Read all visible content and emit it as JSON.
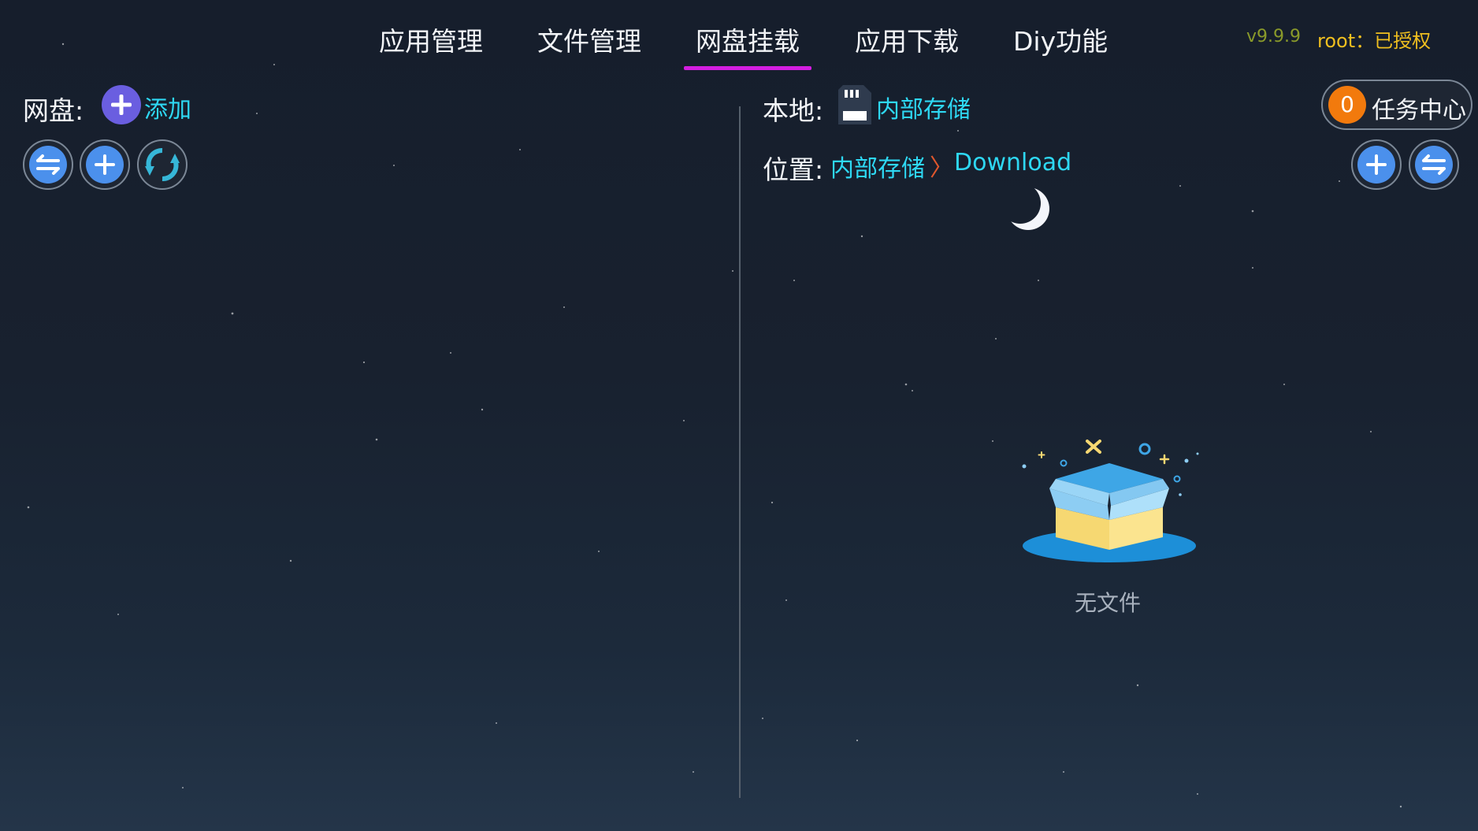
{
  "tabs": [
    {
      "label": "应用管理",
      "active": false
    },
    {
      "label": "文件管理",
      "active": false
    },
    {
      "label": "网盘挂载",
      "active": true
    },
    {
      "label": "应用下载",
      "active": false
    },
    {
      "label": "Diy功能",
      "active": false
    }
  ],
  "status": {
    "version": "v9.9.9",
    "root": "root：已授权"
  },
  "left_panel": {
    "label": "网盘:",
    "add_label": "添加",
    "toolbar": [
      "swap-icon",
      "plus-icon",
      "refresh-icon"
    ]
  },
  "right_panel": {
    "local_label": "本地:",
    "storage_name": "内部存储",
    "path_label": "位置:",
    "breadcrumb": [
      "内部存储",
      "Download"
    ],
    "separator": "〉",
    "task_center": {
      "count": "0",
      "label": "任务中心"
    },
    "toolbar": [
      "plus-icon",
      "swap-icon"
    ],
    "empty_text": "无文件"
  },
  "colors": {
    "accent_link": "#2ed8f3",
    "tab_indicator": "#d31ee0",
    "version": "#8a9a2a",
    "root_status": "#f0bf1f",
    "task_badge": "#f27a0d",
    "button_fill": "#4b90ec",
    "add_button": "#6a5ee0"
  }
}
